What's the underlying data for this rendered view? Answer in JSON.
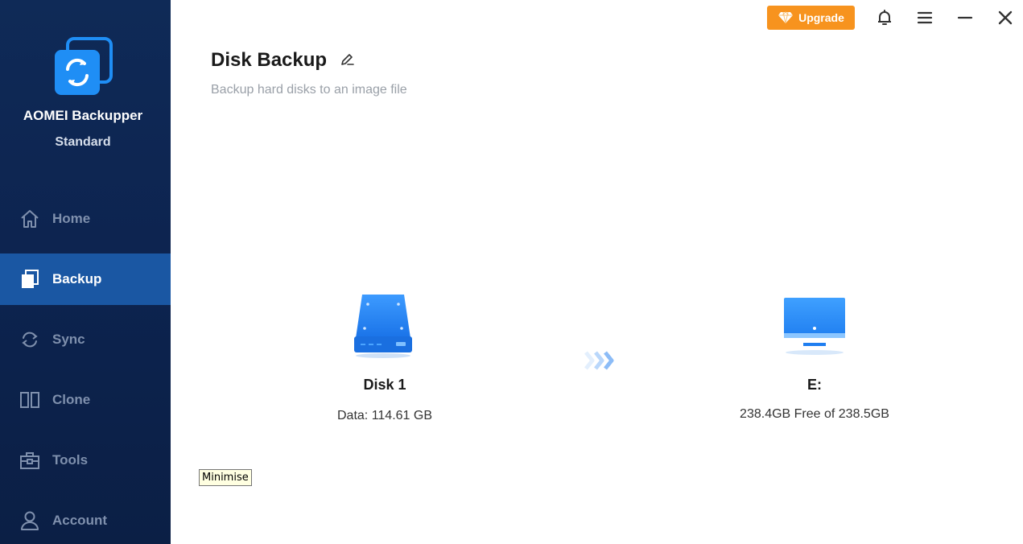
{
  "app": {
    "name": "AOMEI Backupper",
    "edition": "Standard"
  },
  "sidebar": {
    "items": [
      {
        "label": "Home",
        "icon": "home-icon",
        "active": false
      },
      {
        "label": "Backup",
        "icon": "backup-icon",
        "active": true
      },
      {
        "label": "Sync",
        "icon": "sync-icon",
        "active": false
      },
      {
        "label": "Clone",
        "icon": "clone-icon",
        "active": false
      },
      {
        "label": "Tools",
        "icon": "tools-icon",
        "active": false
      },
      {
        "label": "Account",
        "icon": "account-icon",
        "active": false
      }
    ]
  },
  "titlebar": {
    "upgrade_label": "Upgrade",
    "upgrade_icon": "diamond-icon",
    "icons": [
      "bell-icon",
      "menu-icon",
      "minimize-icon",
      "close-icon"
    ]
  },
  "main": {
    "title": "Disk Backup",
    "subtitle": "Backup hard disks to an image file",
    "source": {
      "name": "Disk 1",
      "info": "Data: 114.61 GB"
    },
    "destination": {
      "name": "E:",
      "info": "238.4GB Free of 238.5GB"
    }
  },
  "tooltip": {
    "text": "Minimise"
  },
  "colors": {
    "sidebar_bg": "#0d2450",
    "sidebar_active": "#1a57a3",
    "accent_blue": "#2e86f0",
    "upgrade_orange": "#f7931e"
  }
}
